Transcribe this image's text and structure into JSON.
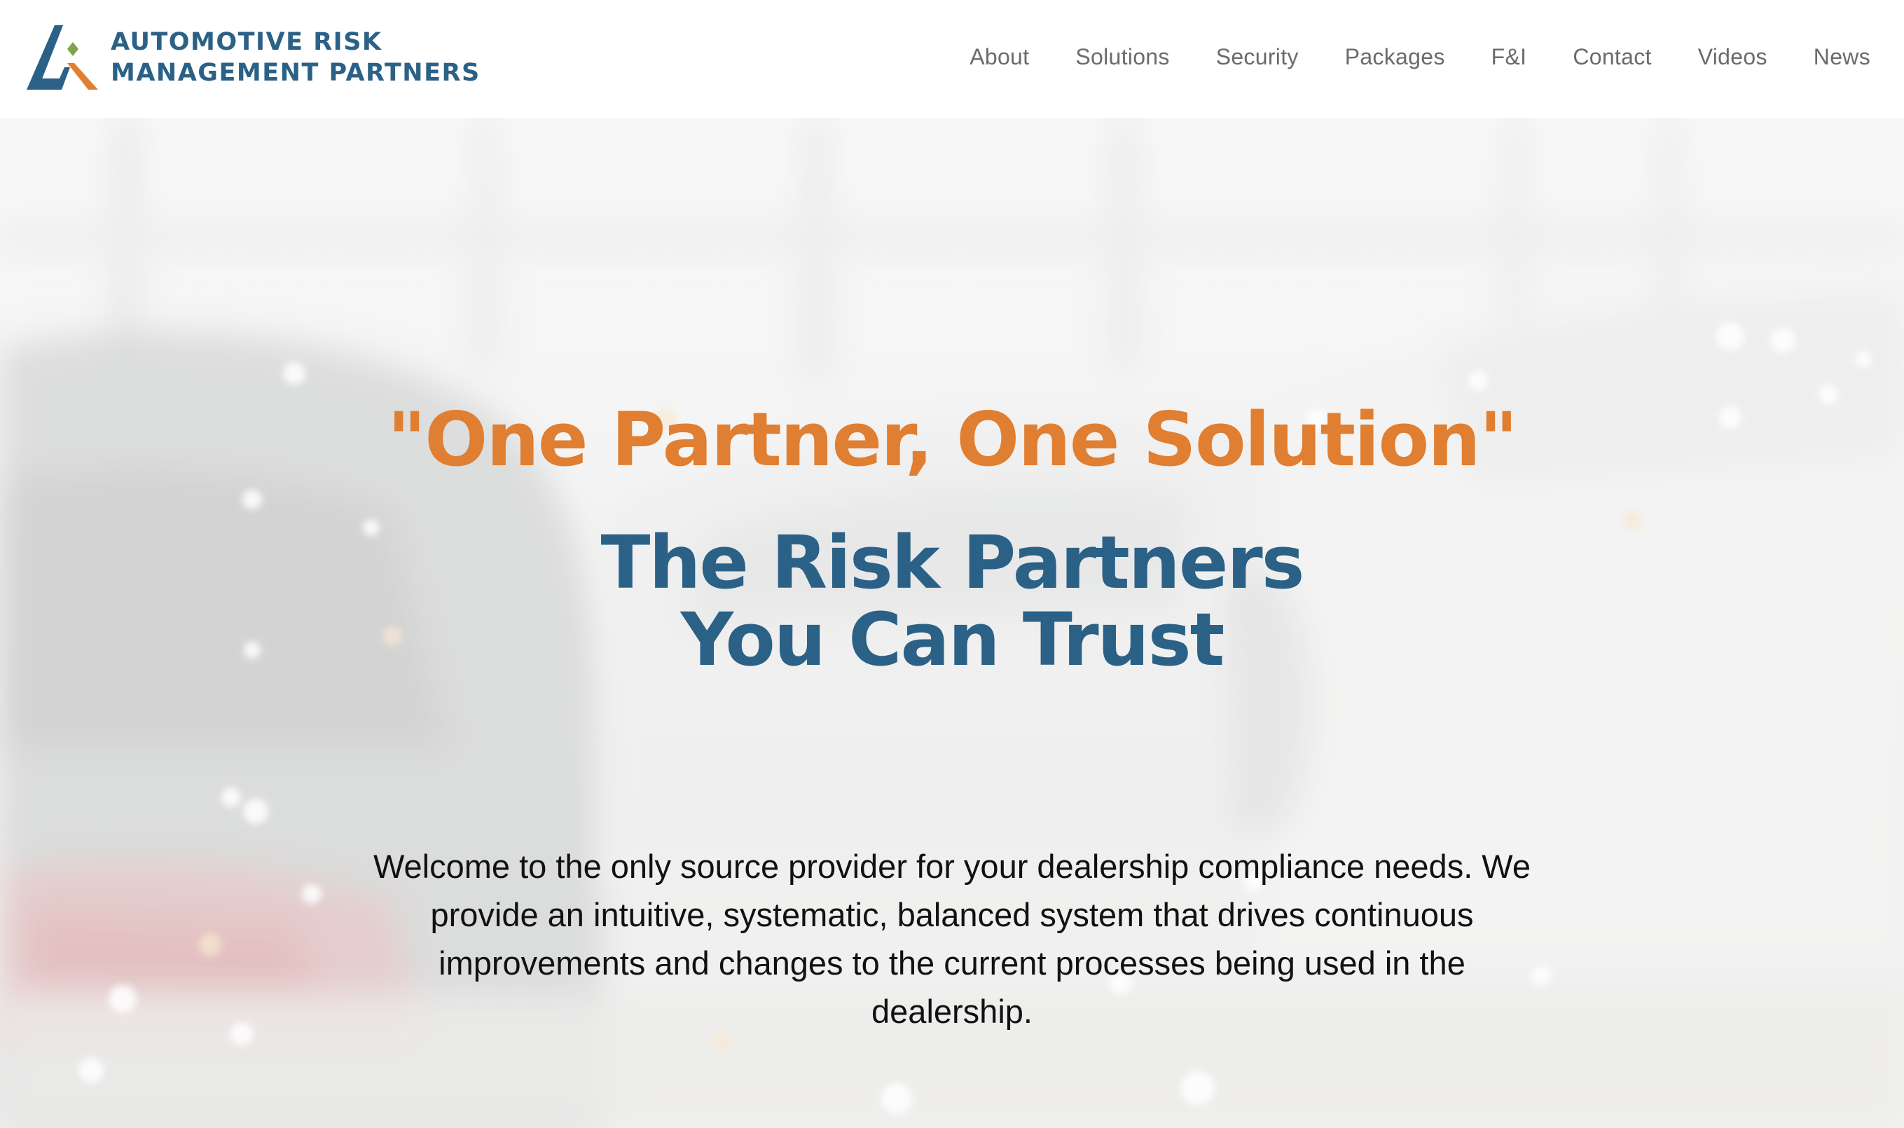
{
  "brand": {
    "name_line1": "AUTOMOTIVE RISK",
    "name_line2": "MANAGEMENT PARTNERS",
    "logo_icon": "arm-triangle-logo-icon",
    "colors": {
      "blue": "#2b6186",
      "orange": "#e07e31",
      "green": "#7ea34a"
    }
  },
  "nav": {
    "items": [
      {
        "label": "About"
      },
      {
        "label": "Solutions"
      },
      {
        "label": "Security"
      },
      {
        "label": "Packages"
      },
      {
        "label": "F&I"
      },
      {
        "label": "Contact"
      },
      {
        "label": "Videos"
      },
      {
        "label": "News"
      }
    ]
  },
  "hero": {
    "tagline": "\"One Partner, One Solution\"",
    "headline_line1": "The Risk Partners",
    "headline_line2": "You Can Trust",
    "intro": "Welcome to the only source provider for your dealership compliance needs. We provide an intuitive, systematic, balanced system that drives continuous improvements and changes to the current processes being used in the dealership.",
    "background_image": "blurred-car-dealership-showroom",
    "colors": {
      "tagline": "#e07e31",
      "headline": "#2b6186",
      "body": "#111111"
    }
  }
}
